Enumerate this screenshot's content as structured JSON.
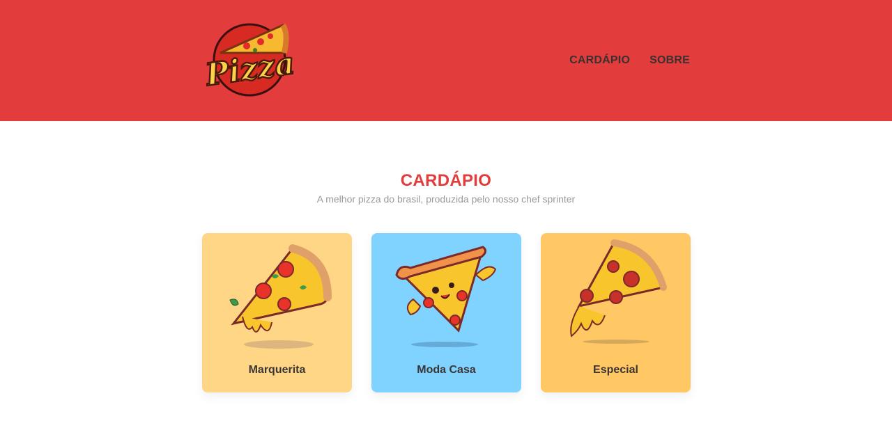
{
  "header": {
    "logo_text": "Pizza",
    "nav": [
      {
        "label": "CARDÁPIO"
      },
      {
        "label": "SOBRE"
      }
    ]
  },
  "menu": {
    "title": "CARDÁPIO",
    "subtitle": "A melhor pizza do brasil, produzida pelo nosso chef sprinter",
    "items": [
      {
        "name": "Marquerita",
        "bg": "#ffd686",
        "icon": "margherita-pizza-slice-icon"
      },
      {
        "name": "Moda Casa",
        "bg": "#80d2ff",
        "icon": "happy-pizza-slice-icon"
      },
      {
        "name": "Especial",
        "bg": "#ffc864",
        "icon": "pepperoni-pizza-slice-icon"
      }
    ]
  },
  "colors": {
    "brand_red": "#e33c3c",
    "nav_text": "#3b3131",
    "subtitle_gray": "#9a9a9a"
  }
}
